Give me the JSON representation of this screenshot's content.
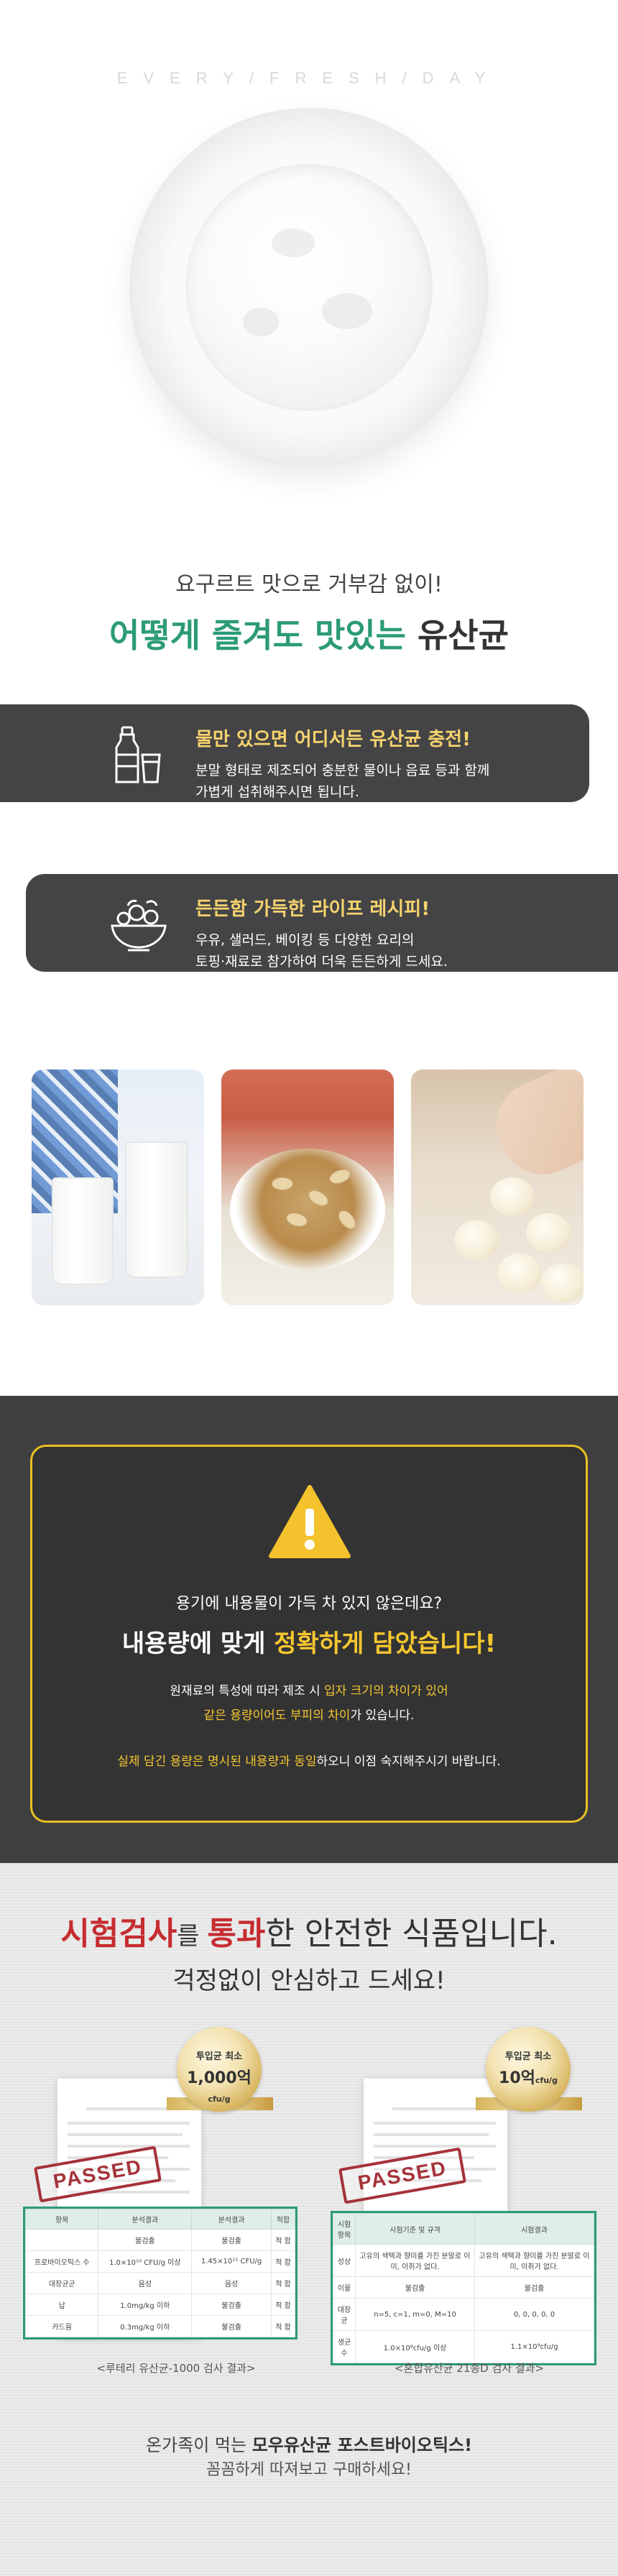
{
  "hero": {
    "tagline": "EVERY/FRESH/DAY",
    "subtitle": "요구르트 맛으로 거부감 없이!",
    "title_green": "어떻게 즐겨도 맛있는",
    "title_dark": "유산균"
  },
  "features": [
    {
      "icon": "bottle-cup-icon",
      "title": "물만 있으면 어디서든 유산균 충전!",
      "line1": "분말 형태로 제조되어 충분한 물이나 음료 등과 함께",
      "line2": "가볍게 섭취해주시면 됩니다."
    },
    {
      "icon": "salad-bowl-icon",
      "title": "든든함 가득한 라이프 레시피!",
      "line1": "우유, 샐러드, 베이킹 등 다양한 요리의",
      "line2": "토핑·재료로 참가하여 더욱 든든하게 드세요."
    }
  ],
  "notice": {
    "question": "용기에 내용물이 가득 차 있지 않은데요?",
    "title_white": "내용량에 맞게 ",
    "title_yellow": "정확하게 담았습니다!",
    "p1_a": "원재료의 특성에 따라 제조 시 ",
    "p1_b": "입자 크기의 차이가 있어",
    "p2_a": "같은 용량이어도 부피의 차이",
    "p2_b": "가 있습니다.",
    "p3_a": "실제 담긴 용량은 명시된 내용량과 동일",
    "p3_b": "하오니 이점 숙지해주시기 바랍니다."
  },
  "test": {
    "title_red1": "시험검사",
    "title_small1": "를 ",
    "title_red2": "통과",
    "title_rest": "한 안전한 식품입니다.",
    "subtitle": "걱정없이 안심하고 드세요!",
    "medal_1_small": "투입균 최소",
    "medal_1_big": "1,000억",
    "medal_1_unit": "cfu/g",
    "medal_2_small": "투입균 최소",
    "medal_2_big": "10억",
    "medal_2_unit": "cfu/g",
    "stamp": "PASSED",
    "table_1_headers": [
      "항목",
      "분석결과",
      "분석결과",
      "적합"
    ],
    "table_1_rows": [
      [
        "",
        "불검출",
        "불검출",
        "적 합"
      ],
      [
        "프로바이오틱스 수",
        "1.0×10¹⁰ CFU/g 이상",
        "1.45×10¹¹ CFU/g",
        "적 합"
      ],
      [
        "대장균군",
        "음성",
        "음성",
        "적 합"
      ],
      [
        "납",
        "1.0mg/kg 이하",
        "불검출",
        "적 합"
      ],
      [
        "카드뮴",
        "0.3mg/kg 이하",
        "불검출",
        "적 합"
      ]
    ],
    "table_2_headers": [
      "시험항목",
      "시험기준 및 규격",
      "시험결과"
    ],
    "table_2_rows": [
      [
        "성상",
        "고유의 색택과 향미를 가진 분말로 이미, 이취가 없다.",
        "고유의 색택과 향미를 가진 분말로 이미, 이취가 없다."
      ],
      [
        "이물",
        "불검출",
        "불검출"
      ],
      [
        "대장균",
        "n=5, c=1, m=0, M=10",
        "0, 0, 0, 0, 0"
      ],
      [
        "생균수",
        "1.0×10⁸cfu/g 이상",
        "1.1×10⁹cfu/g"
      ]
    ],
    "caption_1": "<루테리 유산균-1000 검사 결과>",
    "caption_2": "<혼합유산균 21종D 검사 결과>",
    "footer_1_a": "온가족이 먹는 ",
    "footer_1_b": "모우유산균 포스트바이오틱스!",
    "footer_2": "꼼꼼하게 따져보고 구매하세요!"
  }
}
